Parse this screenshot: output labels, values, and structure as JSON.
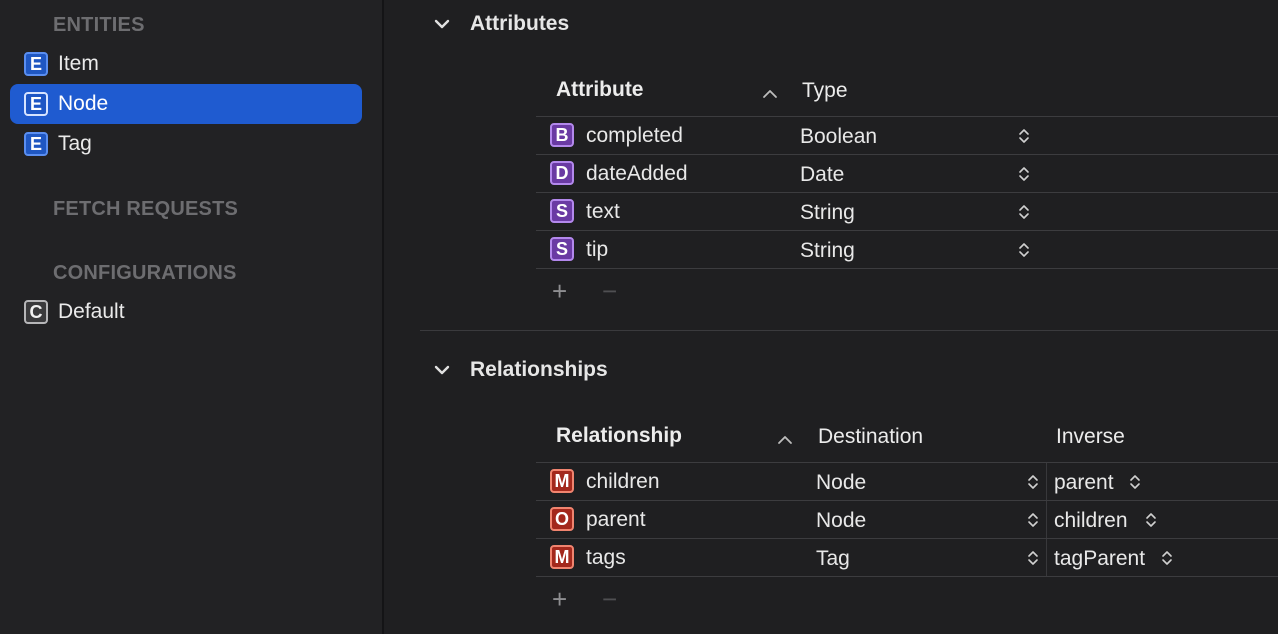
{
  "sidebar": {
    "entities_header": "ENTITIES",
    "entities": [
      {
        "badge": "E",
        "label": "Item"
      },
      {
        "badge": "E",
        "label": "Node"
      },
      {
        "badge": "E",
        "label": "Tag"
      }
    ],
    "selected_entity": "Node",
    "fetch_requests_header": "FETCH REQUESTS",
    "configurations_header": "CONFIGURATIONS",
    "configurations": [
      {
        "badge": "C",
        "label": "Default"
      }
    ]
  },
  "attributes": {
    "section_title": "Attributes",
    "columns": {
      "attribute": "Attribute",
      "type": "Type"
    },
    "rows": [
      {
        "badge": "B",
        "name": "completed",
        "type": "Boolean"
      },
      {
        "badge": "D",
        "name": "dateAdded",
        "type": "Date"
      },
      {
        "badge": "S",
        "name": "text",
        "type": "String"
      },
      {
        "badge": "S",
        "name": "tip",
        "type": "String"
      }
    ],
    "add_label": "+",
    "remove_label": "−"
  },
  "relationships": {
    "section_title": "Relationships",
    "columns": {
      "relationship": "Relationship",
      "destination": "Destination",
      "inverse": "Inverse"
    },
    "rows": [
      {
        "badge": "M",
        "name": "children",
        "destination": "Node",
        "inverse": "parent"
      },
      {
        "badge": "O",
        "name": "parent",
        "destination": "Node",
        "inverse": "children"
      },
      {
        "badge": "M",
        "name": "tags",
        "destination": "Tag",
        "inverse": "tagParent"
      }
    ],
    "add_label": "+",
    "remove_label": "−"
  },
  "colors": {
    "selection": "#1f5bd0",
    "entity_badge": "#1f57c2",
    "attribute_badge": "#6a3aa3",
    "relationship_badge": "#a3281c"
  },
  "icons": {
    "collapse": "chevron-down-icon",
    "sort": "chevron-up-icon",
    "popup": "updown-chevron-icon"
  }
}
